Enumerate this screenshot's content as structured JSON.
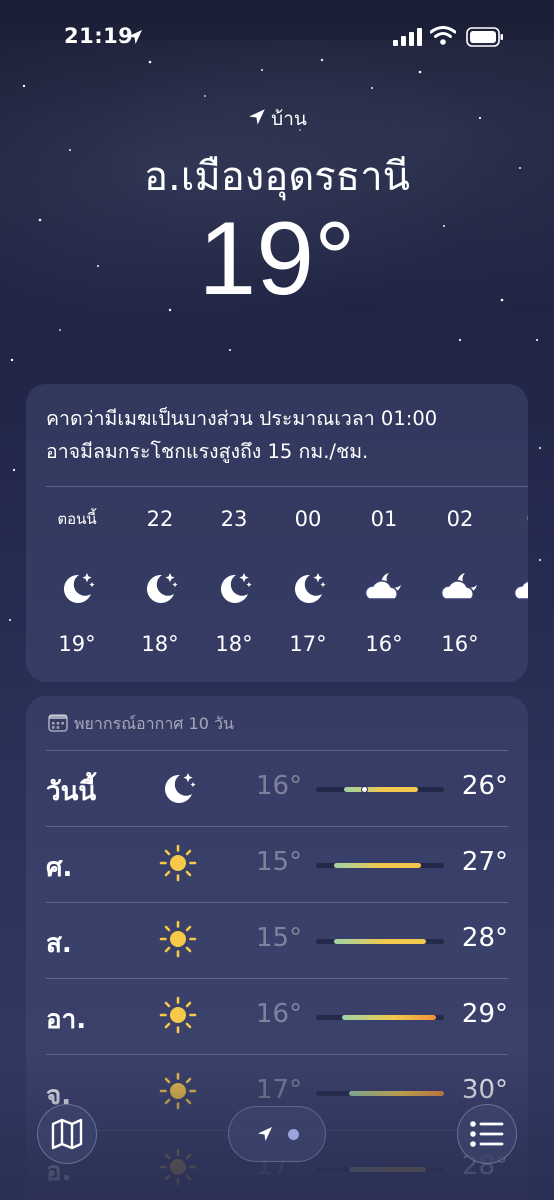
{
  "status_bar": {
    "time": "21:19"
  },
  "header": {
    "location_label": "บ้าน",
    "city": "อ.เมืองอุดรธานี",
    "current_temp": "19°"
  },
  "hourly": {
    "summary_line1": "คาดว่ามีเมฆเป็นบางส่วน ประมาณเวลา 01:00",
    "summary_line2": "อาจมีลมกระโชกแรงสูงถึง 15 กม./ชม.",
    "hours": [
      {
        "label": "ตอนนี้",
        "icon": "moon-stars-icon",
        "temp": "19°"
      },
      {
        "label": "22",
        "icon": "moon-stars-icon",
        "temp": "18°"
      },
      {
        "label": "23",
        "icon": "moon-stars-icon",
        "temp": "18°"
      },
      {
        "label": "00",
        "icon": "moon-stars-icon",
        "temp": "17°"
      },
      {
        "label": "01",
        "icon": "cloud-moon-icon",
        "temp": "16°"
      },
      {
        "label": "02",
        "icon": "cloud-moon-icon",
        "temp": "16°"
      },
      {
        "label": "0",
        "icon": "cloud-moon-icon",
        "temp": "1"
      }
    ]
  },
  "daily": {
    "title": "พยากรณ์อากาศ 10 วัน",
    "days": [
      {
        "name": "วันนี้",
        "icon": "moon-stars-icon",
        "low": "16°",
        "high": "26°",
        "bar_start": 0.22,
        "bar_end": 0.8,
        "current_marker": 0.38
      },
      {
        "name": "ศ.",
        "icon": "sun-icon",
        "low": "15°",
        "high": "27°",
        "bar_start": 0.14,
        "bar_end": 0.82
      },
      {
        "name": "ส.",
        "icon": "sun-icon",
        "low": "15°",
        "high": "28°",
        "bar_start": 0.14,
        "bar_end": 0.86
      },
      {
        "name": "อา.",
        "icon": "sun-icon",
        "low": "16°",
        "high": "29°",
        "bar_start": 0.2,
        "bar_end": 0.94
      },
      {
        "name": "จ.",
        "icon": "sun-icon",
        "low": "17°",
        "high": "30°",
        "bar_start": 0.26,
        "bar_end": 1.0
      },
      {
        "name": "อ.",
        "icon": "sun-icon",
        "low": "17°",
        "high": "28°",
        "bar_start": 0.26,
        "bar_end": 0.86
      }
    ]
  },
  "colors": {
    "bar_cool": "#9fd3a8",
    "bar_mid": "#f2c94c",
    "bar_warm": "#f0913a",
    "sun": "#f7c948"
  }
}
